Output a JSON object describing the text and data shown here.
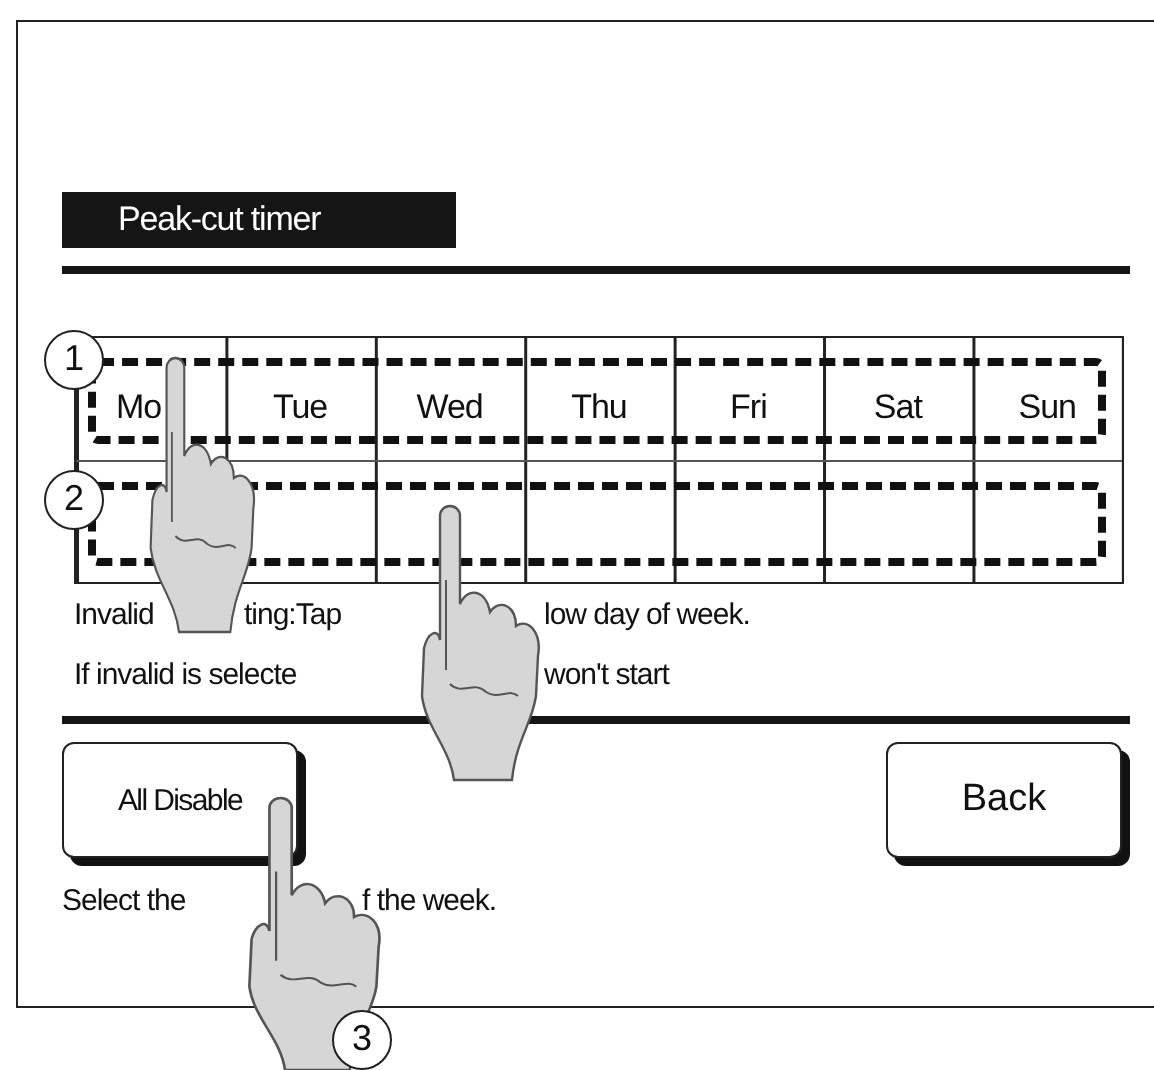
{
  "screen": {
    "title": "Peak-cut timer",
    "day_rows": [
      {
        "callout": "1",
        "cells": [
          "Mo",
          "Tue",
          "Wed",
          "Thu",
          "Fri",
          "Sat",
          "Sun"
        ]
      },
      {
        "callout": "2",
        "cells": [
          "",
          "",
          "",
          "",
          "",
          "",
          ""
        ]
      }
    ],
    "notes": [
      [
        "Invalid",
        "ting:Tap",
        "low day of week."
      ],
      [
        "If invalid is selecte",
        "won't start"
      ]
    ],
    "buttons": [
      {
        "label": "All Disable",
        "kind": "left"
      },
      {
        "label": "Back",
        "kind": "right"
      }
    ],
    "hint": [
      "Select the",
      "f the week."
    ],
    "step_callout": "3"
  }
}
